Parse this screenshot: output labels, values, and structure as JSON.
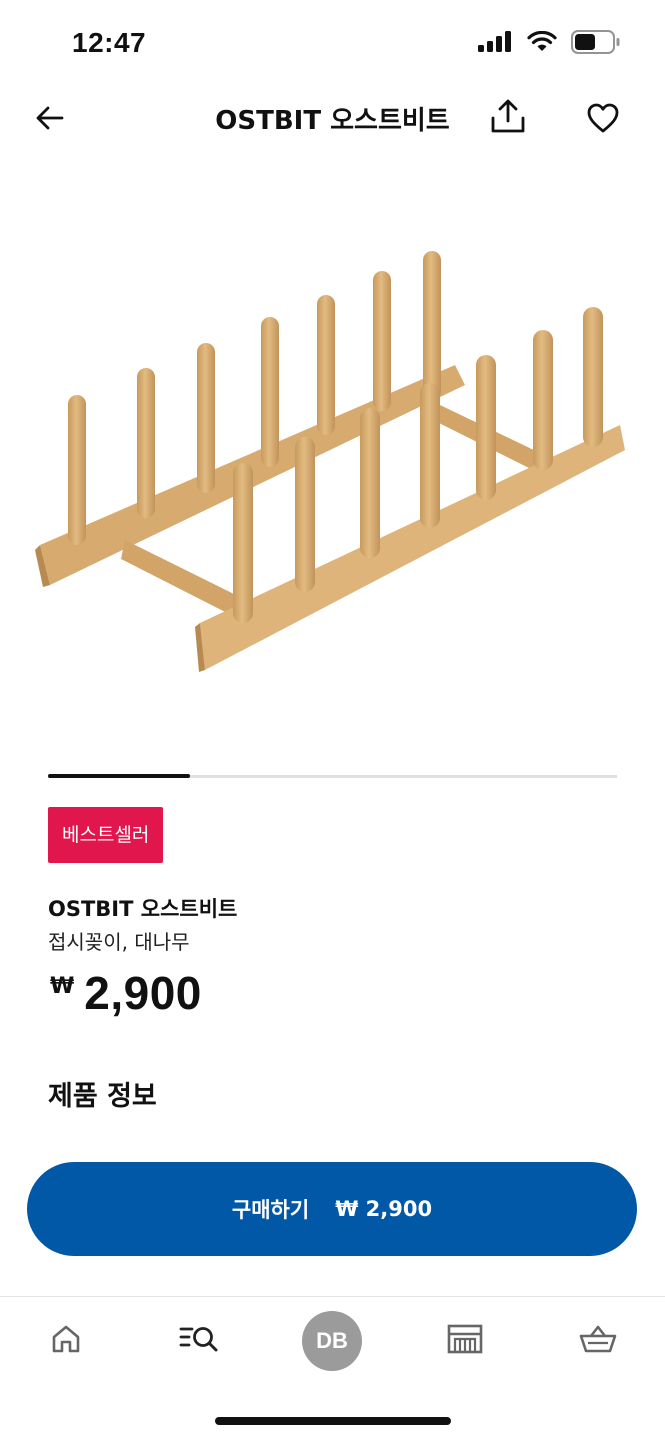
{
  "status_bar": {
    "time": "12:47",
    "icons": [
      "cellular-signal-icon",
      "wifi-icon",
      "battery-icon"
    ]
  },
  "nav": {
    "title": "OSTBIT 오스트비트",
    "back_icon": "arrow-left-icon",
    "share_icon": "share-icon",
    "favorite_icon": "heart-icon"
  },
  "gallery": {
    "image": "dish-rack-product-image",
    "progress": 0.25
  },
  "product": {
    "badge": "베스트셀러",
    "name": "OSTBIT 오스트비트",
    "description": "접시꽂이, 대나무",
    "currency": "₩",
    "price": "2,900"
  },
  "sections": {
    "product_info_title": "제품 정보"
  },
  "buy_button": {
    "label": "구매하기",
    "price": "₩ 2,900"
  },
  "tab_bar": {
    "items": [
      {
        "name": "home",
        "icon": "home-icon"
      },
      {
        "name": "search",
        "icon": "search-list-icon"
      },
      {
        "name": "profile",
        "avatar_initials": "DB"
      },
      {
        "name": "store",
        "icon": "store-icon"
      },
      {
        "name": "cart",
        "icon": "basket-icon"
      }
    ]
  },
  "colors": {
    "accent_blue": "#0158a6",
    "badge_red": "#e0164d",
    "avatar_gray": "#9b9b9b"
  }
}
